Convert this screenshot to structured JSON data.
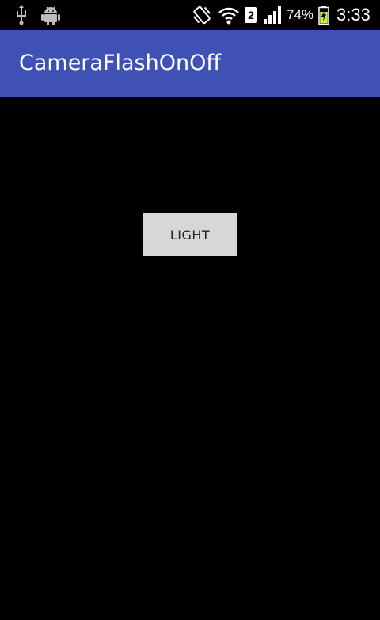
{
  "status_bar": {
    "icons": [
      "usb-icon",
      "android-debug-icon",
      "vibrate-icon",
      "wifi-icon",
      "sim-2-icon",
      "signal-icon",
      "battery-charging-icon"
    ],
    "sim_slot": "2",
    "battery_percent": "74%",
    "time": "3:33"
  },
  "action_bar": {
    "title": "CameraFlashOnOff",
    "color": "#3f51b5"
  },
  "main": {
    "light_button_label": "LIGHT",
    "background": "#000000"
  }
}
